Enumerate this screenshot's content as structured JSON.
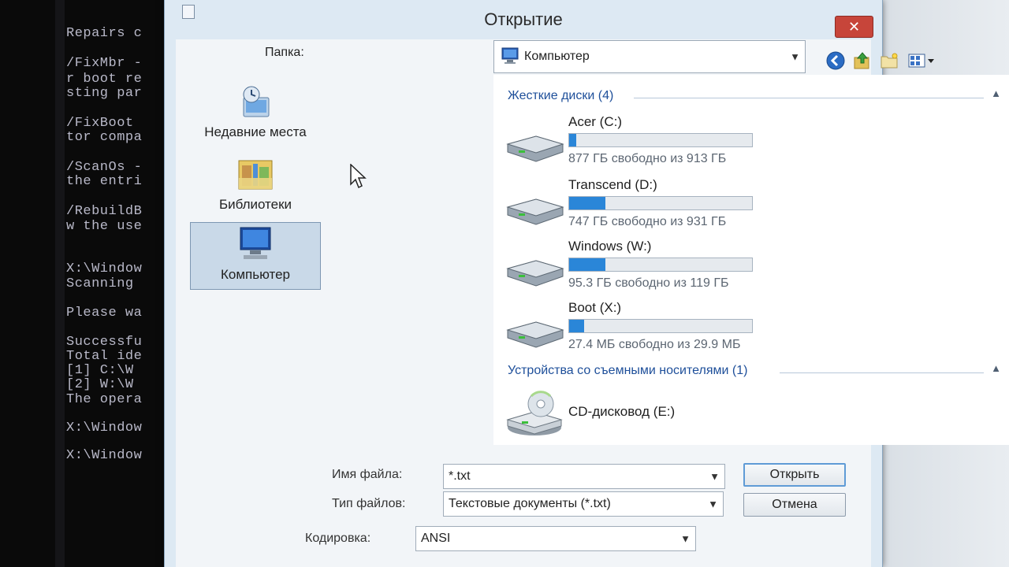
{
  "console": {
    "lines": [
      "Repairs c",
      "/FixMbr -",
      "r boot re",
      "sting par",
      "/FixBoot",
      "tor compa",
      "/ScanOs -",
      "the entri",
      "/RebuildB",
      "w the use",
      "X:\\Window",
      "Scanning",
      "Please wa",
      "Successfu",
      "Total ide",
      "[1]  C:\\W",
      "[2]  W:\\W",
      "The opera",
      "X:\\Window",
      "X:\\Window"
    ]
  },
  "dialog": {
    "title": "Открытие",
    "close_label": "✕",
    "folder_label": "Папка:",
    "folder_value": "Компьютер",
    "toolbar_icons": [
      "back-icon",
      "up-folder-icon",
      "new-folder-icon",
      "view-menu-icon"
    ],
    "nav": [
      {
        "label": "Недавние места",
        "icon": "recent-places-icon",
        "selected": false
      },
      {
        "label": "Библиотеки",
        "icon": "libraries-icon",
        "selected": false
      },
      {
        "label": "Компьютер",
        "icon": "computer-icon",
        "selected": true
      }
    ],
    "groups": {
      "hard_drives": {
        "header": "Жесткие диски (4)",
        "drives": [
          {
            "name": "Acer (C:)",
            "free_text": "877 ГБ свободно из 913 ГБ",
            "used_fraction": 0.04
          },
          {
            "name": "Transcend (D:)",
            "free_text": "747 ГБ свободно из 931 ГБ",
            "used_fraction": 0.2
          },
          {
            "name": "Windows (W:)",
            "free_text": "95.3 ГБ свободно из 119 ГБ",
            "used_fraction": 0.2
          },
          {
            "name": "Boot (X:)",
            "free_text": "27.4 МБ свободно из 29.9 МБ",
            "used_fraction": 0.08
          }
        ]
      },
      "removable": {
        "header": "Устройства со съемными носителями (1)",
        "devices": [
          {
            "name": "CD-дисковод (E:)",
            "icon": "cd-drive-icon"
          }
        ]
      }
    },
    "filename_label": "Имя файла:",
    "filename_value": "*.txt",
    "filetype_label": "Тип файлов:",
    "filetype_value": "Текстовые документы (*.txt)",
    "encoding_label": "Кодировка:",
    "encoding_value": "ANSI",
    "open_button": "Открыть",
    "cancel_button": "Отмена",
    "colors": {
      "accent_blue": "#2a86d8",
      "group_header": "#1e4f9a",
      "close_red": "#c7453a"
    }
  }
}
